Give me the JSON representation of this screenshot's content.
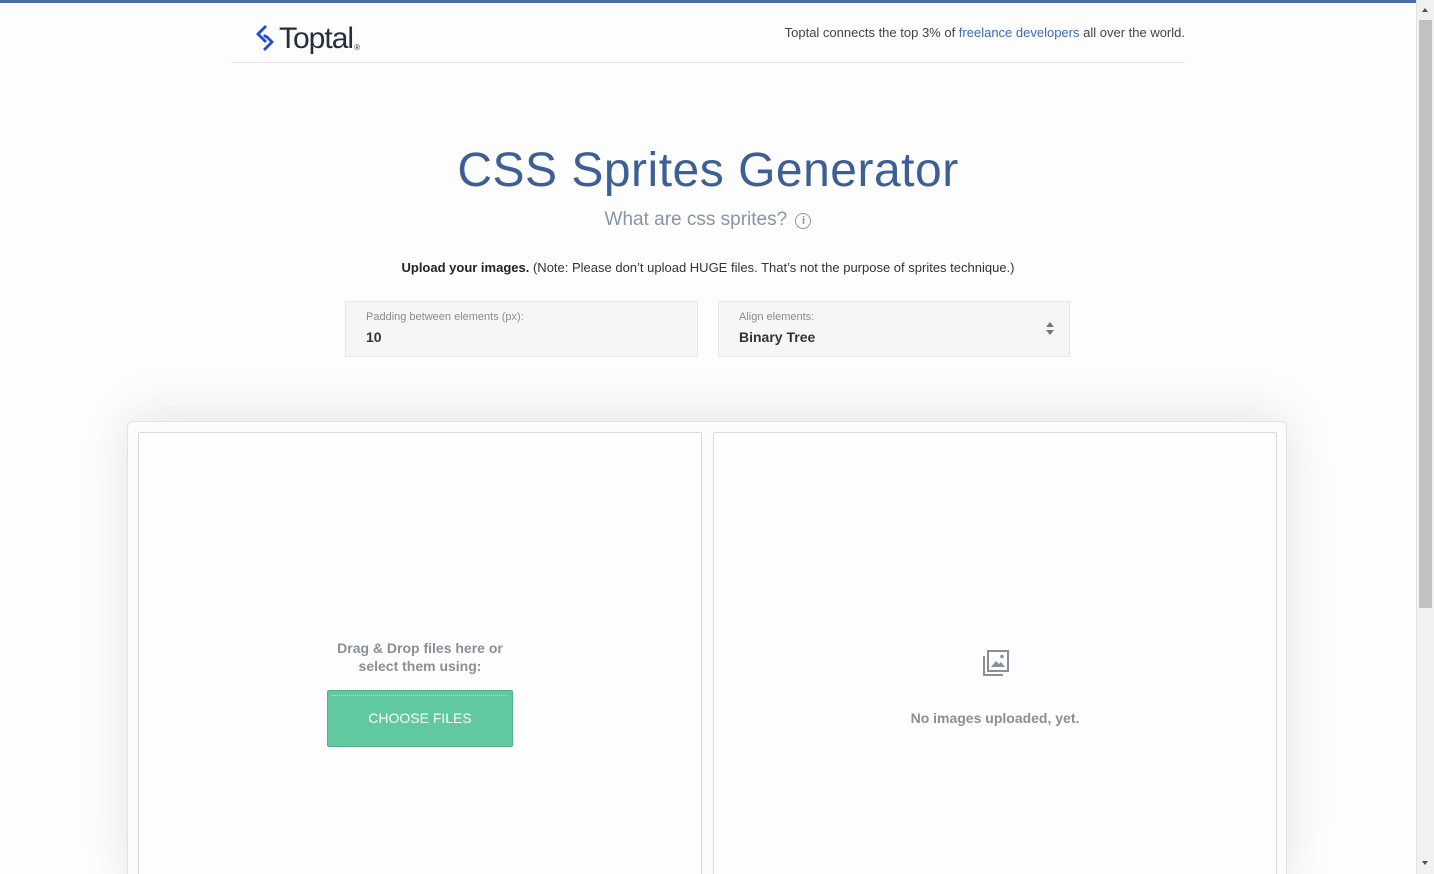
{
  "header": {
    "logo_text": "Toptal",
    "logo_reg": "®",
    "tagline_before": "Toptal connects the top 3% of ",
    "tagline_link": "freelance developers",
    "tagline_after": " all over the world."
  },
  "main": {
    "title": "CSS Sprites Generator",
    "subtitle": "What are css sprites?",
    "info_glyph": "i",
    "upload_bold": "Upload your images.",
    "upload_note": " (Note: Please don’t upload HUGE files. That’s not the purpose of sprites technique.)"
  },
  "settings": {
    "padding_label": "Padding between elements (px):",
    "padding_value": "10",
    "align_label": "Align elements:",
    "align_value": "Binary Tree"
  },
  "dropzone": {
    "line1": "Drag & Drop files here or",
    "line2": "select them using:",
    "button_label": "CHOOSE FILES"
  },
  "preview": {
    "icon": "image-gallery-icon",
    "empty_text": "No images uploaded, yet."
  },
  "colors": {
    "accent": "#3c5f96",
    "link": "#3b6bb5",
    "button": "#61c9a0",
    "logo_blue": "#204ecf"
  }
}
